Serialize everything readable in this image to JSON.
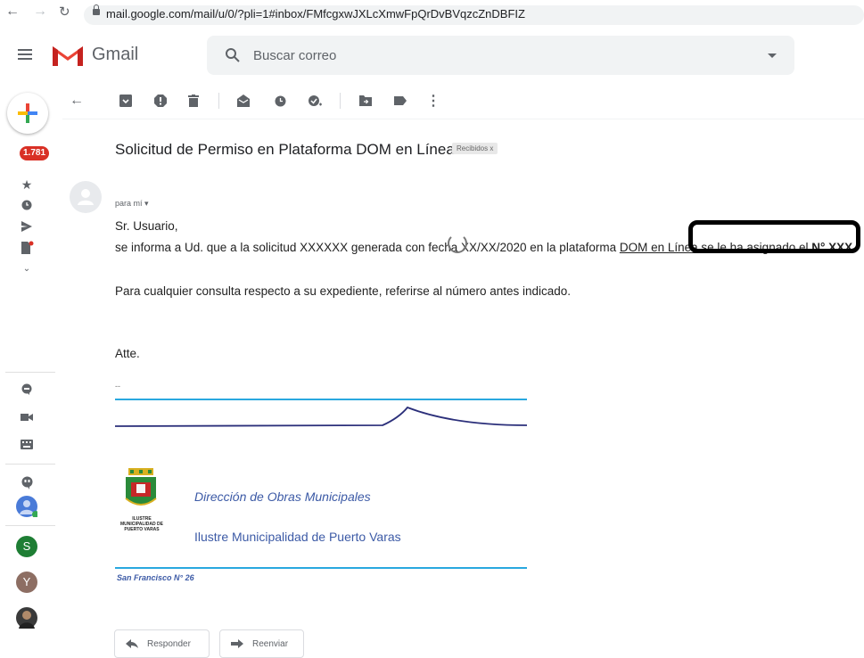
{
  "browser": {
    "url": "mail.google.com/mail/u/0/?pli=1#inbox/FMfcgxwJXLcXmwFpQrDvBVqzcZnDBFIZ"
  },
  "header": {
    "app_name": "Gmail",
    "search_placeholder": "Buscar correo"
  },
  "rail": {
    "inbox_count": "1.781",
    "avatars": [
      {
        "letter": "S",
        "color": "#1e7e34"
      },
      {
        "letter": "Y",
        "color": "#8d6e63"
      }
    ]
  },
  "message": {
    "subject": "Solicitud de Permiso en Plataforma DOM en Línea",
    "label": "Recibidos",
    "label_close": "x",
    "to": "para mí",
    "greeting": "Sr. Usuario,",
    "line1_prefix": "se informa a Ud. que a la solicitud XXXXXX generada con fecha XX/XX/2020 en la plataforma ",
    "line1_link": "DOM en Línea",
    "line1_suffix": " se le ha asignado el ",
    "line1_bold": "N° XXX",
    "line1_end": ".",
    "line2": "Para cualquier consulta respecto a su expediente, referirse al número antes indicado.",
    "closing": "Atte.",
    "sig_dash": "--"
  },
  "signature": {
    "dept": "Dirección de Obras Municipales",
    "municipality": "Ilustre Municipalidad de Puerto Varas",
    "crest_caption": "ILUSTRE MUNICIPALIDAD DE PUERTO VARAS",
    "address": "San Francisco N° 26"
  },
  "actions": {
    "reply": "Responder",
    "forward": "Reenviar"
  },
  "colors": {
    "accent_blue": "#29a8df",
    "navy": "#2b2f7a",
    "badge_red": "#d93025"
  }
}
